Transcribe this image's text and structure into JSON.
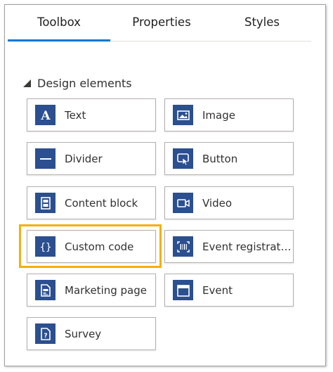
{
  "tabs": [
    {
      "label": "Toolbox",
      "active": true
    },
    {
      "label": "Properties",
      "active": false
    },
    {
      "label": "Styles",
      "active": false
    }
  ],
  "section": {
    "title": "Design elements",
    "icon": "collapse-triangle-icon"
  },
  "elements": [
    {
      "label": "Text",
      "icon": "text-icon"
    },
    {
      "label": "Image",
      "icon": "image-icon"
    },
    {
      "label": "Divider",
      "icon": "divider-icon"
    },
    {
      "label": "Button",
      "icon": "button-icon"
    },
    {
      "label": "Content block",
      "icon": "content-block-icon"
    },
    {
      "label": "Video",
      "icon": "video-icon"
    },
    {
      "label": "Custom code",
      "icon": "custom-code-icon",
      "highlighted": true
    },
    {
      "label": "Event registrati...",
      "icon": "event-registration-icon"
    },
    {
      "label": "Marketing page",
      "icon": "marketing-page-icon"
    },
    {
      "label": "Event",
      "icon": "event-icon"
    },
    {
      "label": "Survey",
      "icon": "survey-icon"
    }
  ],
  "colors": {
    "accent": "#0078d4",
    "icon_bg": "#2b4f8f",
    "highlight": "#f2b10a"
  }
}
